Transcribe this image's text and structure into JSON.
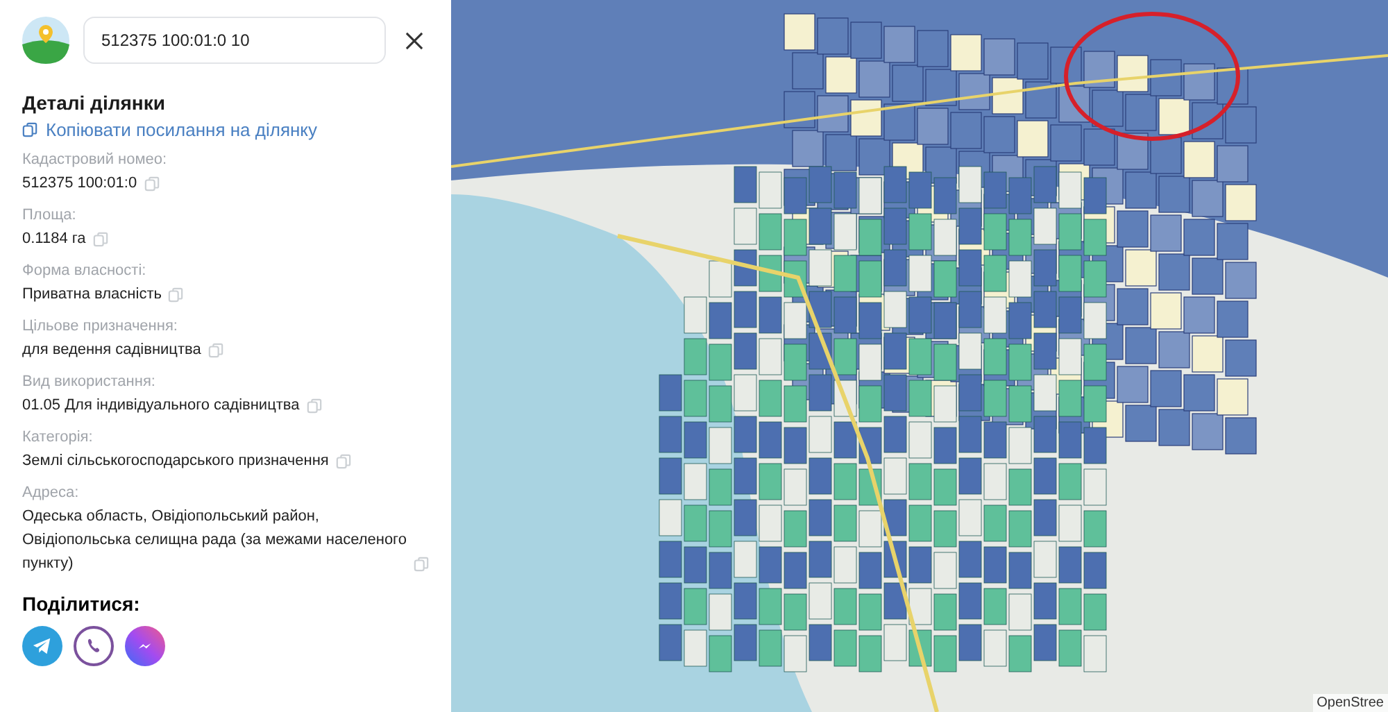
{
  "search": {
    "value": "512375 100:01:0 10"
  },
  "details": {
    "title": "Деталі ділянки",
    "copy_link": "Копіювати посилання на ділянку",
    "fields": [
      {
        "label": "Кадастровий номео:",
        "value": "512375 100:01:0"
      },
      {
        "label": "Площа:",
        "value": "0.1184 га"
      },
      {
        "label": "Форма власності:",
        "value": "Приватна власність"
      },
      {
        "label": "Цільове призначення:",
        "value": "для ведення садівництва"
      },
      {
        "label": "Вид використання:",
        "value": "01.05 Для індивідуального садівництва"
      },
      {
        "label": "Категорія:",
        "value": "Землі сільськогосподарського призначення"
      },
      {
        "label": "Адреса:",
        "value": "Одеська область, Овідіопольський район, Овідіопольська селищна рада (за межами населеного пункту)"
      }
    ]
  },
  "share": {
    "title": "Поділитися:",
    "buttons": [
      {
        "kind": "telegram"
      },
      {
        "kind": "viber"
      },
      {
        "kind": "messenger"
      }
    ]
  },
  "map": {
    "attribution": "OpenStree"
  }
}
